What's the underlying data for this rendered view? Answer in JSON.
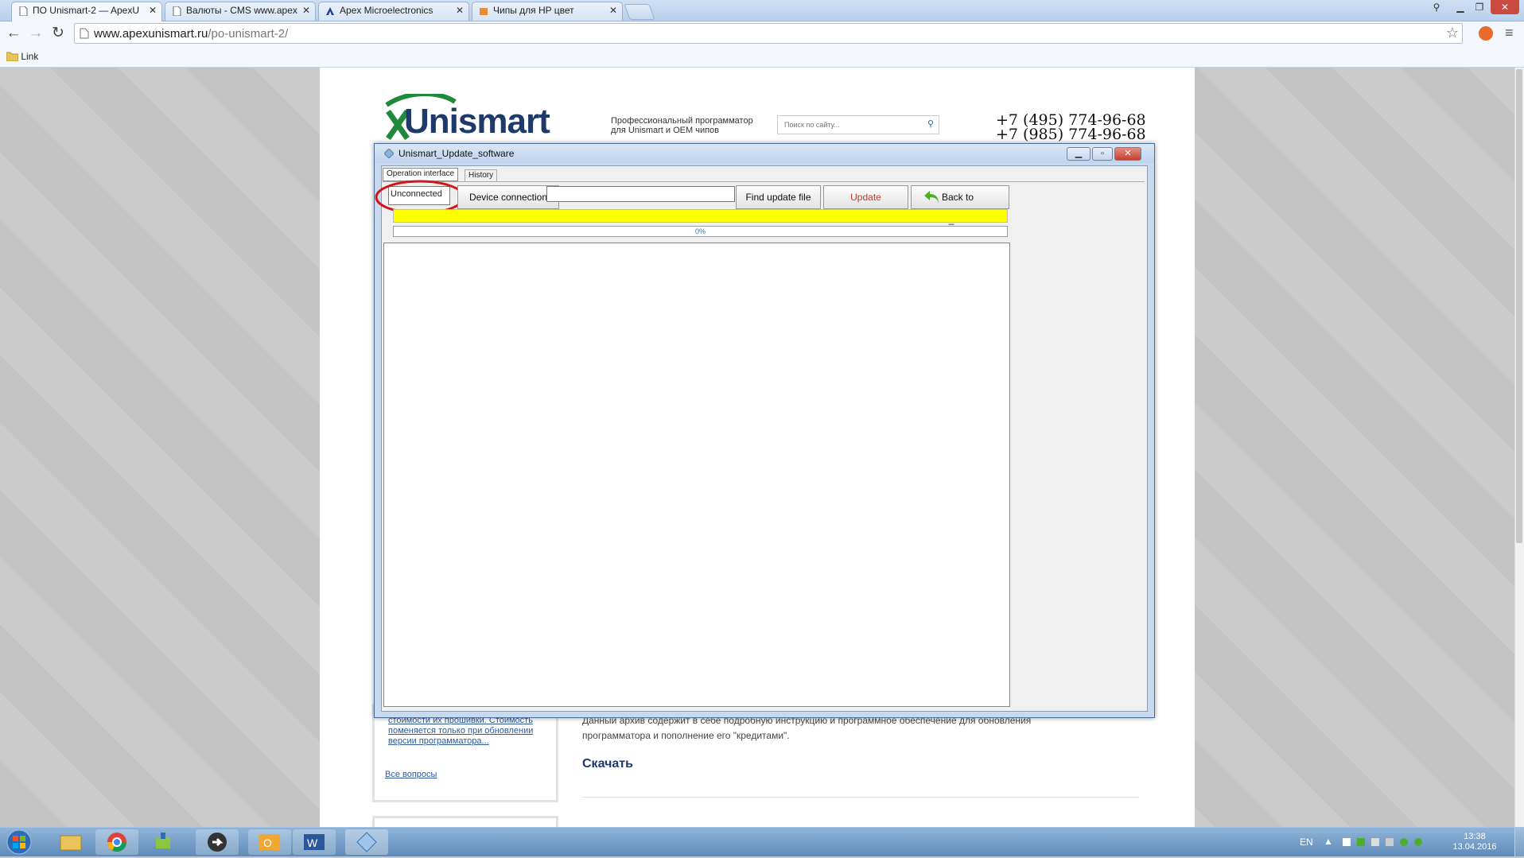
{
  "browser": {
    "tabs": [
      {
        "label": "ПО Unismart-2 — ApexU",
        "active": true
      },
      {
        "label": "Валюты - CMS www.apex",
        "active": false
      },
      {
        "label": "Apex Microelectronics",
        "active": false
      },
      {
        "label": "Чипы для HP цвет",
        "active": false
      }
    ],
    "url_host": "www.apexunismart.ru",
    "url_path": "/po-unismart-2/",
    "bookmark": "Link"
  },
  "site": {
    "logo": "Unismart",
    "tagline": "Профессиональный программатор для Unismart и OEM чипов",
    "search_placeholder": "Поиск по сайту...",
    "phone1": "+7 (495) 774-96-68",
    "phone2": "+7 (985) 774-96-68",
    "sidebar_text": "стоимости их прошивки. Стоимость поменяется только при обновлении версии программатора...",
    "sidebar_link": "Все вопросы",
    "article_text": "Данный архив содержит в себе подробную инструкцию и программное обеспечение для обновления программатора и пополнение его \"кредитами\".",
    "download_link": "Скачать"
  },
  "app": {
    "title": "Unismart_Update_software",
    "tabs": [
      "Operation interface",
      "History"
    ],
    "status": "Unconnected",
    "device_connection": "Device connection",
    "file_path": "",
    "find_update": "Find update file",
    "update": "Update",
    "back": "Back to U_Packet",
    "progress_label": "0%",
    "progress": 0,
    "status_color": "#ffff00",
    "update_color": "#c0392b"
  },
  "taskbar": {
    "lang": "EN",
    "time": "13:38",
    "date": "13.04.2016"
  }
}
